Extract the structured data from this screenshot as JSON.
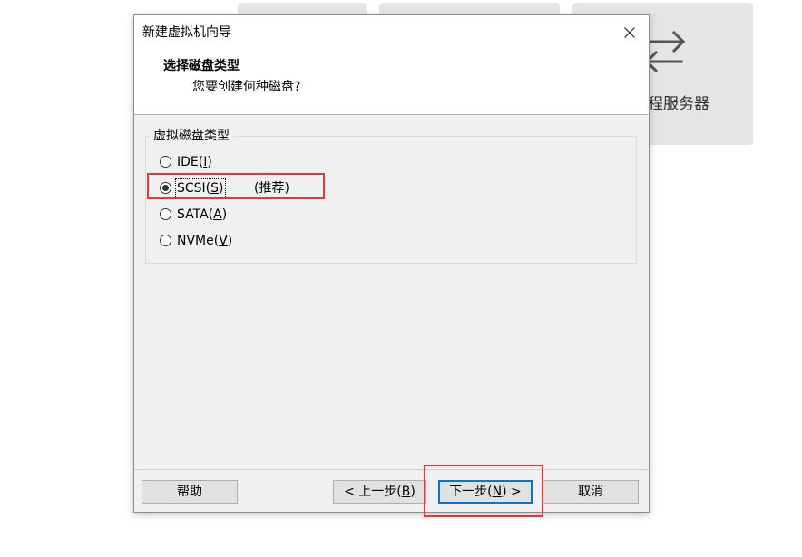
{
  "background": {
    "tiles": [
      {
        "label": ""
      },
      {
        "label": ""
      },
      {
        "label": "远程服务器",
        "icon": "swap-arrows-icon"
      }
    ]
  },
  "dialog": {
    "title": "新建虚拟机向导",
    "close_icon": "close-icon",
    "header": {
      "heading": "选择磁盘类型",
      "subheading": "您要创建何种磁盘?"
    },
    "group": {
      "label": "虚拟磁盘类型",
      "options": [
        {
          "pre": "IDE(",
          "key": "I",
          "post": ")",
          "selected": false
        },
        {
          "pre": "SCSI(",
          "key": "S",
          "post": ")",
          "note": "(推荐)",
          "selected": true
        },
        {
          "pre": "SATA(",
          "key": "A",
          "post": ")",
          "selected": false
        },
        {
          "pre": "NVMe(",
          "key": "V",
          "post": ")",
          "selected": false
        }
      ]
    },
    "buttons": {
      "help": {
        "label": "帮助"
      },
      "back": {
        "pre": "< 上一步(",
        "key": "B",
        "post": ")"
      },
      "next": {
        "pre": "下一步(",
        "key": "N",
        "post": ") >"
      },
      "cancel": {
        "label": "取消"
      }
    }
  },
  "colors": {
    "annotation": "#e53935",
    "default_button_border": "#0078d7",
    "dialog_body": "#f0f0f0",
    "tile": "#e5e5e5"
  }
}
